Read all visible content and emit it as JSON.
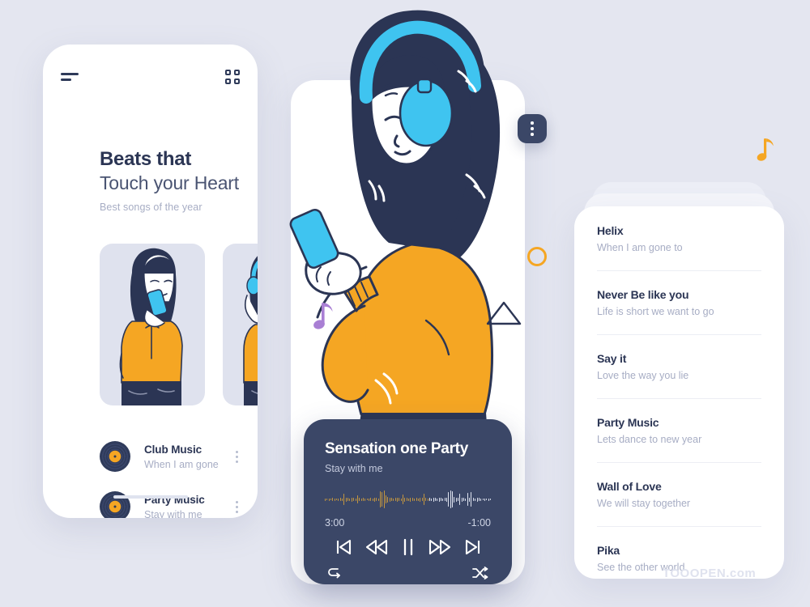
{
  "background_color": "#e4e6f0",
  "palette": {
    "navy": "#2b3554",
    "player_navy": "#3b4767",
    "orange": "#f5a623",
    "cyan": "#3fc4f0",
    "purple": "#a97fd4",
    "muted_text": "#a7adc4",
    "panel_white": "#ffffff",
    "card_lavender": "#dfe2ee"
  },
  "left_panel": {
    "menu_icon": "hamburger-icon",
    "grid_icon": "grid-icon",
    "title_line1": "Beats that",
    "title_line2": "Touch your Heart",
    "subtitle": "Best songs of the year",
    "illustration_cards": [
      {
        "name": "girl-with-phone-illustration"
      },
      {
        "name": "girl-with-headphones-illustration"
      }
    ],
    "tracks": [
      {
        "name": "Club Music",
        "sub": "When I am gone",
        "icon": "vinyl-record-icon",
        "more": "kebab-menu-icon"
      },
      {
        "name": "Party Music",
        "sub": "Stay with me",
        "icon": "vinyl-record-icon",
        "more": "kebab-menu-icon"
      }
    ]
  },
  "center_panel": {
    "illustration": "woman-listening-with-headphones",
    "player": {
      "title": "Sensation one Party",
      "subtitle": "Stay with me",
      "elapsed": "3:00",
      "remaining": "-1:00",
      "progress_ratio": 0.62,
      "waveform_bars": [
        3,
        2,
        3,
        2,
        4,
        3,
        2,
        3,
        4,
        3,
        14,
        5,
        4,
        3,
        5,
        4,
        3,
        10,
        4,
        3,
        4,
        3,
        2,
        3,
        4,
        3,
        5,
        4,
        3,
        20,
        18,
        22,
        10,
        7,
        5,
        4,
        3,
        4,
        5,
        4,
        3,
        12,
        5,
        4,
        3,
        5,
        4,
        3,
        4,
        3,
        5,
        4,
        14,
        4,
        3,
        4,
        3,
        5,
        4,
        3,
        5,
        4,
        3,
        4,
        5,
        18,
        22,
        20,
        7,
        5,
        4,
        14,
        5,
        4,
        3,
        16,
        5,
        18,
        4,
        3,
        5,
        4,
        3,
        2,
        3,
        2,
        3,
        2
      ],
      "controls": [
        {
          "name": "previous-track-button",
          "icon": "skip-back-icon"
        },
        {
          "name": "rewind-button",
          "icon": "rewind-icon"
        },
        {
          "name": "pause-button",
          "icon": "pause-icon"
        },
        {
          "name": "fast-forward-button",
          "icon": "fast-forward-icon"
        },
        {
          "name": "next-track-button",
          "icon": "skip-forward-icon"
        }
      ],
      "repeat_icon": "repeat-icon",
      "shuffle_icon": "shuffle-icon"
    },
    "menu_chip_icon": "vertical-dots-icon"
  },
  "right_panel": {
    "items": [
      {
        "name": "Helix",
        "sub": "When I am gone to"
      },
      {
        "name": "Never Be like you",
        "sub": "Life is short we want to go"
      },
      {
        "name": "Say it",
        "sub": "Love the way you lie"
      },
      {
        "name": "Party Music",
        "sub": "Lets dance to new year"
      },
      {
        "name": "Wall of Love",
        "sub": "We will stay together"
      },
      {
        "name": "Pika",
        "sub": "See the other world"
      }
    ]
  },
  "decorations": {
    "ring": "orange-circle-outline",
    "triangle": "triangle-outline",
    "note_left": "purple-music-note",
    "note_right": "orange-music-note"
  },
  "watermark": "TOOOPEN.com"
}
